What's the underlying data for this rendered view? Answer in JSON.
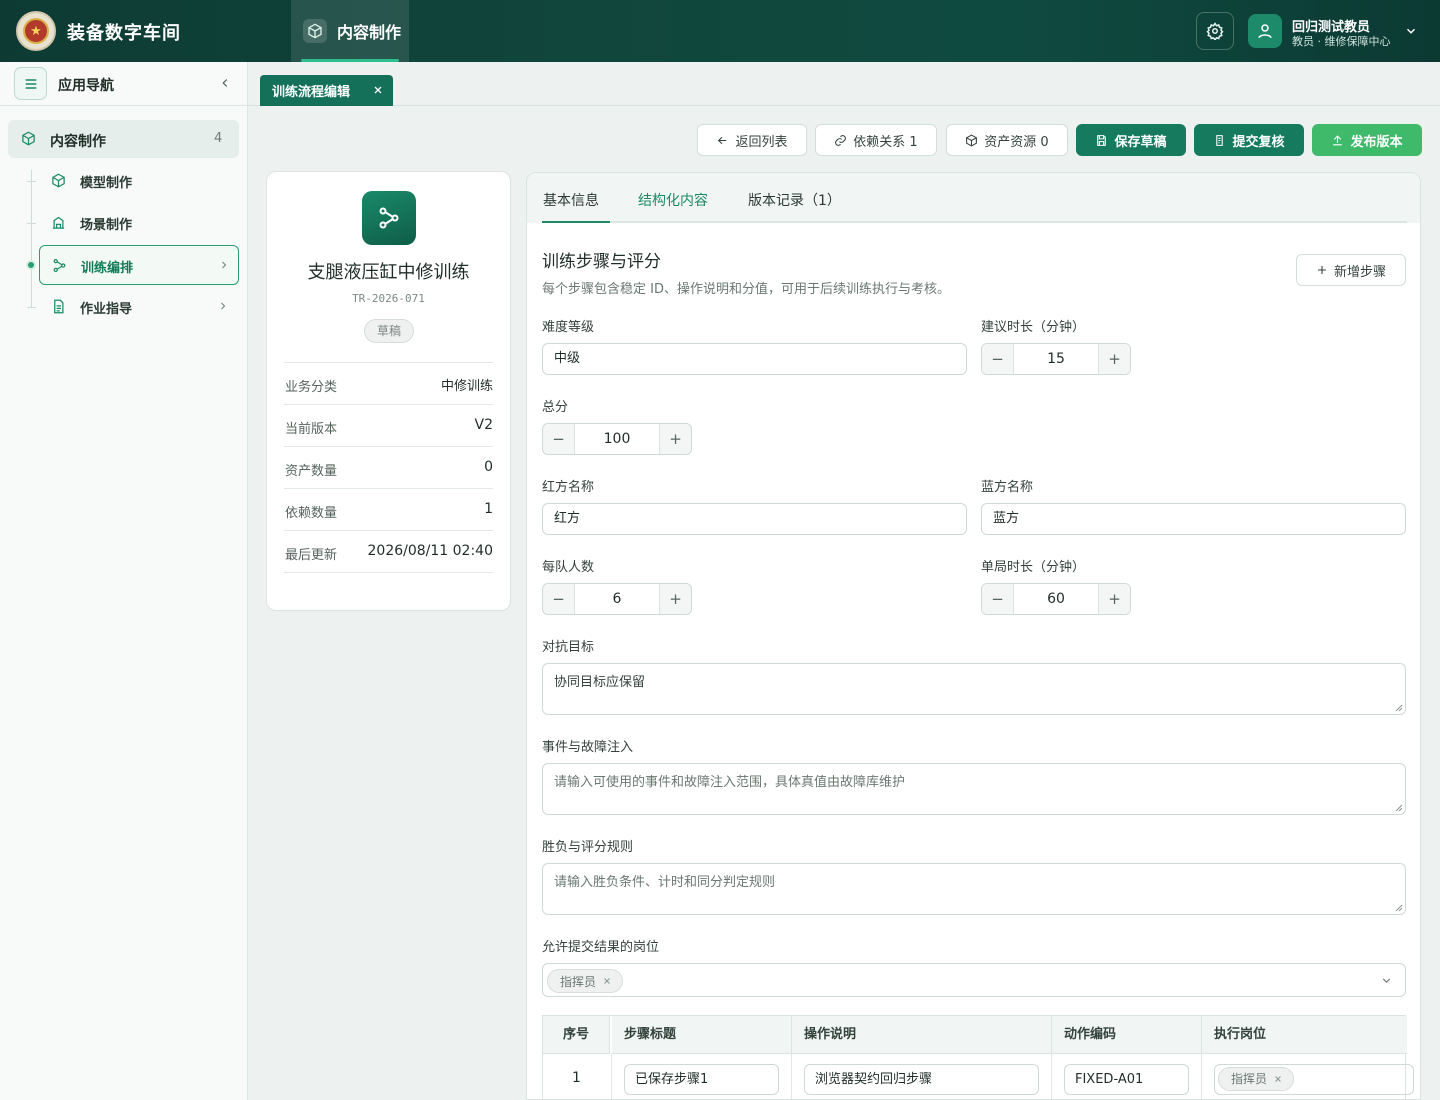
{
  "app": {
    "title": "装备数字车间",
    "module_tab": "内容制作"
  },
  "user": {
    "name": "回归测试教员",
    "role": "教员 · 维修保障中心"
  },
  "sidebar": {
    "title": "应用导航",
    "group": {
      "label": "内容制作",
      "count": "4"
    },
    "items": [
      {
        "label": "模型制作",
        "icon": "cube-icon"
      },
      {
        "label": "场景制作",
        "icon": "building-icon"
      },
      {
        "label": "训练编排",
        "icon": "flow-icon",
        "active": true
      },
      {
        "label": "作业指导",
        "icon": "document-icon"
      }
    ]
  },
  "page_tab": {
    "label": "训练流程编辑"
  },
  "actions": {
    "back": "返回列表",
    "deps": "依赖关系 1",
    "assets": "资产资源 0",
    "save": "保存草稿",
    "submit": "提交复核",
    "publish": "发布版本"
  },
  "info": {
    "title": "支腿液压缸中修训练",
    "code": "TR-2026-071",
    "status": "草稿",
    "rows": [
      {
        "k": "业务分类",
        "v": "中修训练"
      },
      {
        "k": "当前版本",
        "v": "V2"
      },
      {
        "k": "资产数量",
        "v": "0"
      },
      {
        "k": "依赖数量",
        "v": "1"
      },
      {
        "k": "最后更新",
        "v": "2026/08/11 02:40"
      }
    ]
  },
  "tabs": [
    "基本信息",
    "结构化内容",
    "版本记录（1）"
  ],
  "section": {
    "title": "训练步骤与评分",
    "desc": "每个步骤包含稳定 ID、操作说明和分值，可用于后续训练执行与考核。",
    "add_step": "新增步骤"
  },
  "form": {
    "difficulty_label": "难度等级",
    "difficulty": "中级",
    "duration_label": "建议时长（分钟）",
    "duration": "15",
    "total_label": "总分",
    "total": "100",
    "red_label": "红方名称",
    "red": "红方",
    "blue_label": "蓝方名称",
    "blue": "蓝方",
    "team_size_label": "每队人数",
    "team_size": "6",
    "round_label": "单局时长（分钟）",
    "round": "60",
    "objective_label": "对抗目标",
    "objective": "协同目标应保留",
    "events_label": "事件与故障注入",
    "events_placeholder": "请输入可使用的事件和故障注入范围，具体真值由故障库维护",
    "rules_label": "胜负与评分规则",
    "rules_placeholder": "请输入胜负条件、计时和同分判定规则",
    "roles_label": "允许提交结果的岗位",
    "roles_tag": "指挥员"
  },
  "table": {
    "headers": [
      "序号",
      "步骤标题",
      "操作说明",
      "动作编码",
      "执行岗位"
    ],
    "rows": [
      {
        "index": "1",
        "title": "已保存步骤1",
        "desc": "浏览器契约回归步骤",
        "code": "FIXED-A01",
        "role": "指挥员"
      }
    ]
  }
}
